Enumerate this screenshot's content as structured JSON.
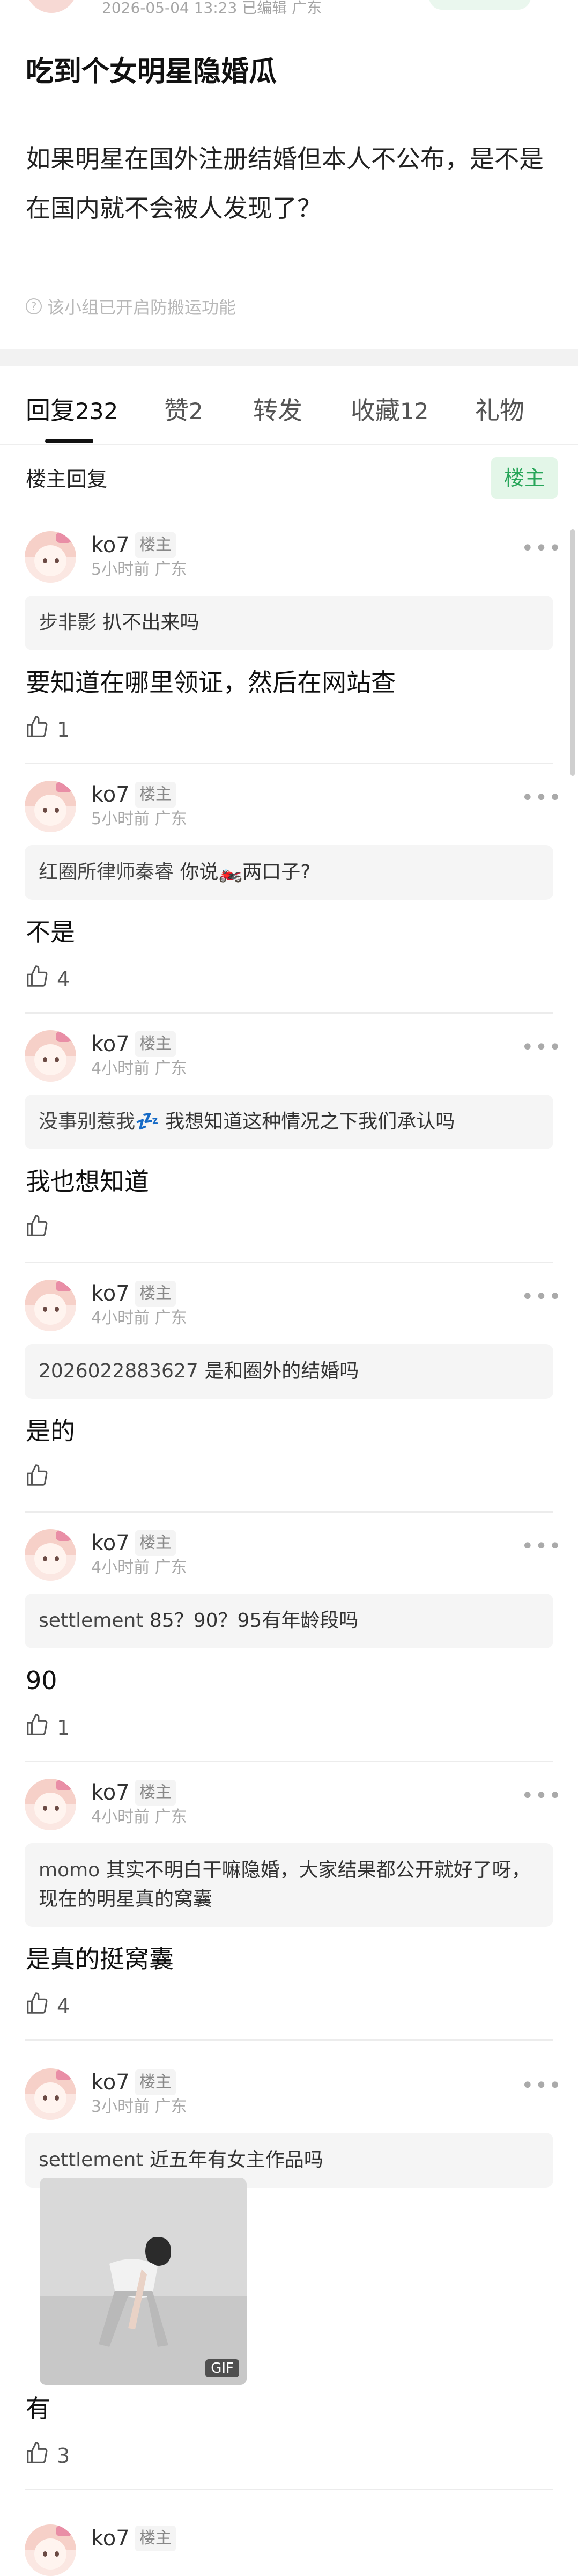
{
  "post": {
    "meta_text": "2026-05-04 13:23  已编辑  广东",
    "title": "吃到个女明星隐婚瓜",
    "body": "如果明星在国外注册结婚但本人不公布，是不是在国内就不会被人发现了？",
    "anti_notice": "该小组已开启防搬运功能"
  },
  "tabs": [
    {
      "label": "回复",
      "count": "232"
    },
    {
      "label": "赞",
      "count": "2"
    },
    {
      "label": "转发",
      "count": ""
    },
    {
      "label": "收藏",
      "count": "12"
    },
    {
      "label": "礼物",
      "count": ""
    }
  ],
  "owner_reply_label": "楼主回复",
  "owner_filter_label": "楼主",
  "comments": [
    {
      "user": "ko7",
      "role": "楼主",
      "meta": "5小时前 广东",
      "quote_name": "步非影",
      "quote_text": "扒不出来吗",
      "reply": "要知道在哪里领证，然后在网站查",
      "likes": "1"
    },
    {
      "user": "ko7",
      "role": "楼主",
      "meta": "5小时前 广东",
      "quote_name": "红圈所律师秦睿",
      "quote_text": "你说🏍️两口子?",
      "reply": "不是",
      "likes": "4"
    },
    {
      "user": "ko7",
      "role": "楼主",
      "meta": "4小时前 广东",
      "quote_name": "没事别惹我💤",
      "quote_text": "我想知道这种情况之下我们承认吗",
      "reply": "我也想知道",
      "likes": ""
    },
    {
      "user": "ko7",
      "role": "楼主",
      "meta": "4小时前 广东",
      "quote_name": "2026022883627",
      "quote_text": "是和圈外的结婚吗",
      "reply": "是的",
      "likes": ""
    },
    {
      "user": "ko7",
      "role": "楼主",
      "meta": "4小时前 广东",
      "quote_name": "settlement",
      "quote_text": "85？90？95有年龄段吗",
      "reply": "90",
      "likes": "1"
    },
    {
      "user": "ko7",
      "role": "楼主",
      "meta": "4小时前 广东",
      "quote_name": "momo",
      "quote_text": "其实不明白干嘛隐婚，大家结果都公开就好了呀，现在的明星真的窝囊",
      "reply": "是真的挺窝囊",
      "likes": "4"
    },
    {
      "user": "ko7",
      "role": "楼主",
      "meta": "3小时前 广东",
      "quote_name": "settlement",
      "quote_text": "近五年有女主作品吗",
      "reply": "有",
      "likes": "3",
      "gif_label": "GIF"
    },
    {
      "user": "ko7",
      "role": "楼主",
      "meta": "",
      "quote_name": "",
      "quote_text": "",
      "reply": "",
      "likes": ""
    }
  ],
  "colors": {
    "accent_green": "#28a65a",
    "pill_bg": "#e3f6e8",
    "quote_bg": "#f5f5f5"
  }
}
